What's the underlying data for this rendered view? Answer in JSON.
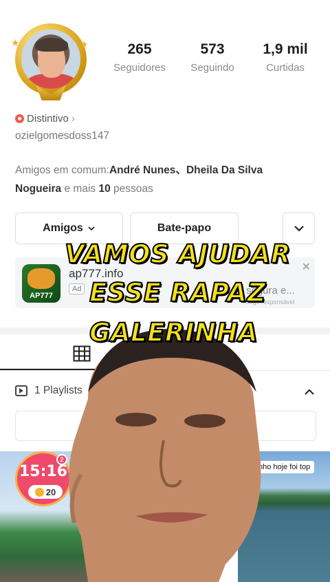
{
  "profile": {
    "stats": [
      {
        "value": "265",
        "label": "Seguidores"
      },
      {
        "value": "573",
        "label": "Seguindo"
      },
      {
        "value": "1,9 mil",
        "label": "Curtidas"
      }
    ],
    "badge_label": "Distintivo",
    "username": "ozielgomesdoss147",
    "mutual": {
      "prefix": "Amigos em comum:",
      "name1": "André Nunes",
      "sep": "、",
      "name2": "Dheila Da Silva Nogueira",
      "mid": " e mais ",
      "count": "10",
      "suffix": " pessoas"
    }
  },
  "actions": {
    "friends_label": "Amigos",
    "chat_label": "Bate-papo"
  },
  "ad": {
    "logo_text": "AP777",
    "url": "ap777.info",
    "tag": "Ad",
    "desc": "segura e...",
    "responsible": "Jogo responsável"
  },
  "playlist": {
    "label": "1 Playlists"
  },
  "videos": {
    "timer": "15:16",
    "coins": "20",
    "bubble": "2",
    "right_caption": "nho hoje foi top"
  },
  "overlay": {
    "line1": "VAMOS AJUDAR",
    "line2": "ESSE RAPAZ",
    "line3": "GALERINHA"
  },
  "colors": {
    "overlay_text": "#f3e01b",
    "badge": "#ef5b4f",
    "timer": "#ef4a6a"
  }
}
